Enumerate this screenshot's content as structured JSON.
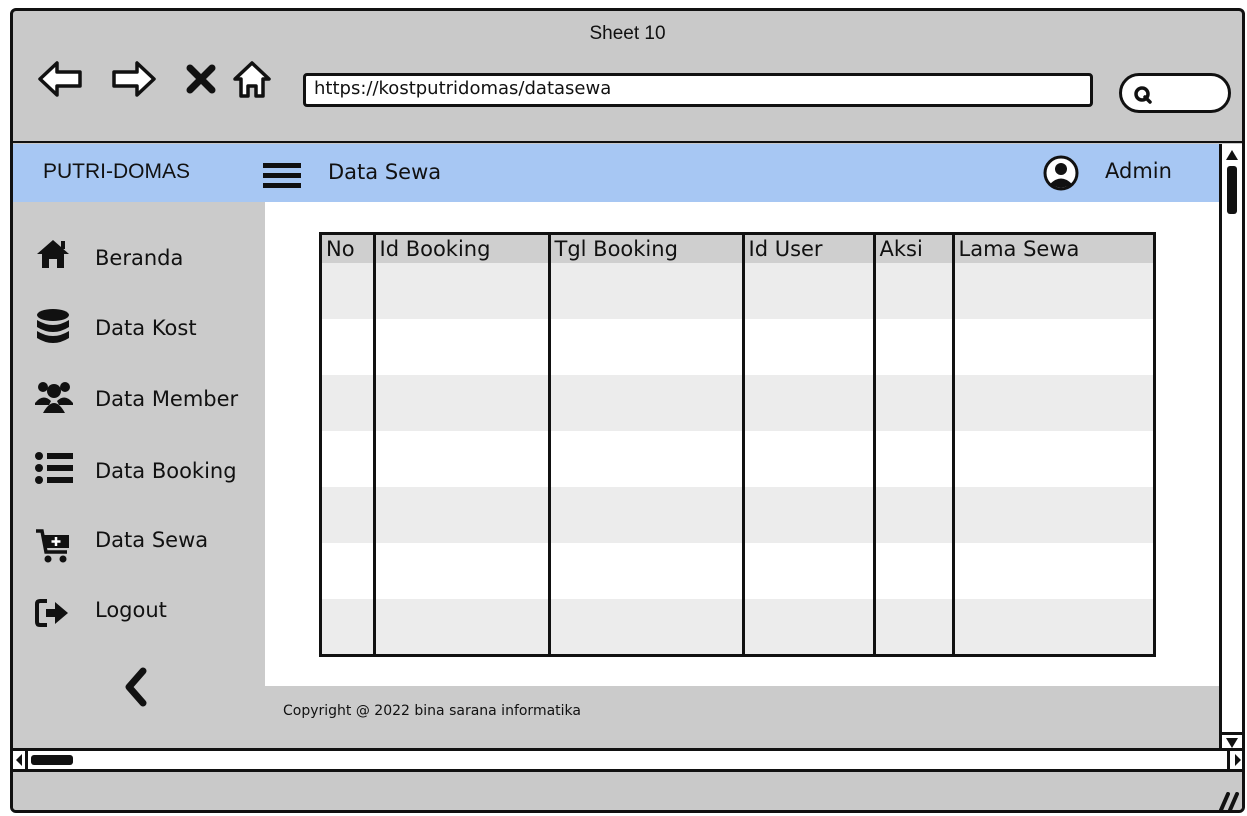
{
  "window": {
    "title": "Sheet 10"
  },
  "browser": {
    "url": "https://kostputridomas/datasewa",
    "nav_icons": [
      "back-arrow-icon",
      "forward-arrow-icon",
      "close-x-icon",
      "home-icon"
    ],
    "search_icon": "search-icon"
  },
  "appbar": {
    "brand": "PUTRI-DOMAS",
    "menu_icon": "hamburger-icon",
    "page_title": "Data Sewa",
    "user_icon": "user-circle-icon",
    "user_label": "Admin",
    "color": "#a7c7f3"
  },
  "sidebar": {
    "items": [
      {
        "label": "Beranda",
        "icon": "home-icon"
      },
      {
        "label": "Data Kost",
        "icon": "database-icon"
      },
      {
        "label": "Data Member",
        "icon": "users-icon"
      },
      {
        "label": "Data Booking",
        "icon": "list-icon"
      },
      {
        "label": "Data Sewa",
        "icon": "cart-icon"
      },
      {
        "label": "Logout",
        "icon": "logout-icon"
      }
    ],
    "collapse_icon": "chevron-left-icon"
  },
  "table": {
    "columns": [
      "No",
      "Id Booking",
      "Tgl Booking",
      "Id User",
      "Aksi",
      "Lama Sewa"
    ],
    "rows": [
      [
        "",
        "",
        "",
        "",
        "",
        ""
      ],
      [
        "",
        "",
        "",
        "",
        "",
        ""
      ],
      [
        "",
        "",
        "",
        "",
        "",
        ""
      ],
      [
        "",
        "",
        "",
        "",
        "",
        ""
      ],
      [
        "",
        "",
        "",
        "",
        "",
        ""
      ],
      [
        "",
        "",
        "",
        "",
        "",
        ""
      ],
      [
        "",
        "",
        "",
        "",
        "",
        ""
      ]
    ]
  },
  "footer": {
    "text": "Copyright @ 2022 bina sarana informatika"
  }
}
